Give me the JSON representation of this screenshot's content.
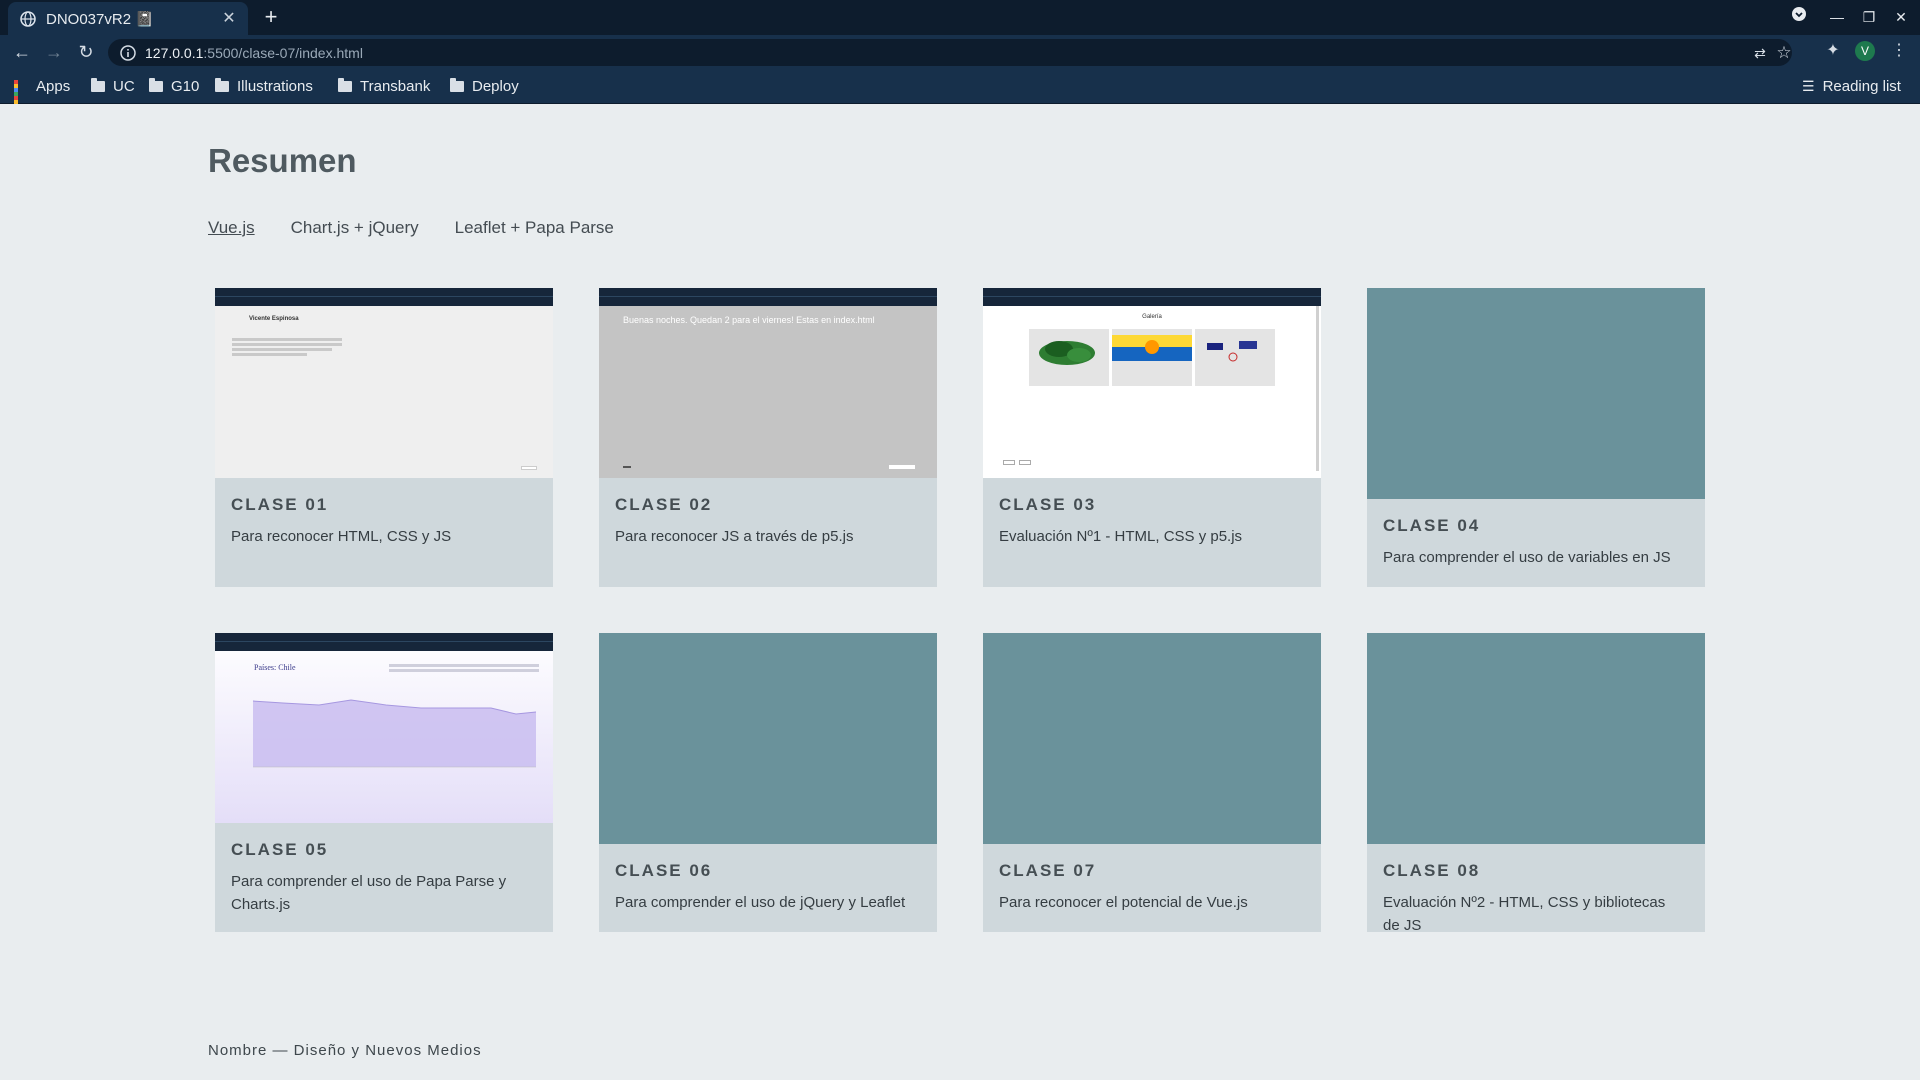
{
  "browser": {
    "tab_title": "DNO037vR2 📓",
    "url_host": "127.0.0.1",
    "url_path": ":5500/clase-07/index.html",
    "bookmarks": [
      "Apps",
      "UC",
      "G10",
      "Illustrations",
      "Transbank",
      "Deploy"
    ],
    "reading_list": "Reading list",
    "profile_initial": "V"
  },
  "page": {
    "title": "Resumen",
    "nav": [
      "Vue.js",
      "Chart.js + jQuery",
      "Leaflet + Papa Parse"
    ],
    "footer": "Nombre — Diseño y Nuevos Medios"
  },
  "cards": [
    {
      "label": "CLASE 01",
      "desc": "Para reconocer HTML, CSS y JS",
      "thumb": "screenshot"
    },
    {
      "label": "CLASE 02",
      "desc": "Para reconocer JS a través de p5.js",
      "thumb": "screenshot"
    },
    {
      "label": "CLASE 03",
      "desc": "Evaluación Nº1 - HTML, CSS y p5.js",
      "thumb": "screenshot"
    },
    {
      "label": "CLASE 04",
      "desc": "Para comprender el uso de variables en JS",
      "thumb": "placeholder"
    },
    {
      "label": "CLASE 05",
      "desc": "Para comprender el uso de Papa Parse y Charts.js",
      "thumb": "screenshot"
    },
    {
      "label": "CLASE 06",
      "desc": "Para comprender el uso de jQuery y Leaflet",
      "thumb": "placeholder"
    },
    {
      "label": "CLASE 07",
      "desc": "Para reconocer el potencial de Vue.js",
      "thumb": "placeholder"
    },
    {
      "label": "CLASE 08",
      "desc": "Evaluación Nº2 - HTML, CSS y bibliotecas de JS",
      "thumb": "placeholder"
    }
  ],
  "thumb_text": {
    "c1_name": "Vicente Espinosa",
    "c2_msg": "Buenas noches. Quedan 2 para el viernes! Estas en index.html",
    "c3_title": "Galería",
    "c5_title": "Países: Chile"
  },
  "colors": {
    "chrome": "#17304b",
    "placeholder": "#6a929b",
    "card": "#cfd8dc",
    "page": "#e9edef"
  }
}
